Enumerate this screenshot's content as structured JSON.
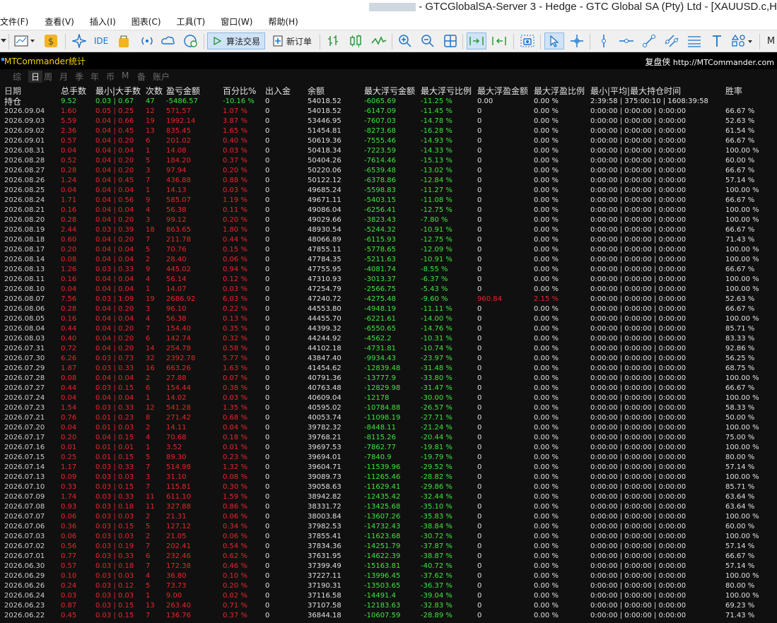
{
  "window": {
    "title": "- GTCGlobalSA-Server 3 - Hedge - GTC Global SA (Pty) Ltd - [XAUUSD.c,H"
  },
  "menu": [
    "文件(F)",
    "查看(V)",
    "插入(I)",
    "图表(C)",
    "工具(T)",
    "窗口(W)",
    "帮助(H)"
  ],
  "toolbar": {
    "ide_label": "IDE",
    "algo_label": "算法交易",
    "new_order_label": "新订单",
    "more_label": "M"
  },
  "panel": {
    "title": "MTCommander统计",
    "link_zh": "复盘侠",
    "link_url": "http://MTCommander.com",
    "tabs": [
      "综",
      "日",
      "周",
      "月",
      "季",
      "年",
      "币",
      "M",
      "备",
      "账户"
    ],
    "active_tab": "日",
    "headers": [
      "日期",
      "总手数",
      "最小|大手数",
      "次数",
      "盈亏金额",
      "百分比%",
      "出入金",
      "余额",
      "最大浮亏金额",
      "最大浮亏比例",
      "最大浮盈金额",
      "最大浮盈比例",
      "最小|平均|最大持仓时间",
      "胜率"
    ],
    "summary": {
      "label": "持仓",
      "lots": "9.52",
      "minmax": "0.03 | 0.67",
      "count": "47",
      "pl": "-5486.57",
      "pct": "-10.16 %",
      "deposit": "0",
      "balance": "54018.52",
      "max_float_loss": "-6065.69",
      "max_float_loss_pct": "-11.25 %",
      "max_float_profit": "0.00",
      "max_float_profit_pct": "0.00 %",
      "hold": "2:39:58 | 375:00:10 | 1608:39:58",
      "win": ""
    }
  },
  "rows": [
    [
      "2026.09.04",
      "1.60",
      "0.05 | 0.25",
      "12",
      "571.57",
      "1.07 %",
      "0",
      "54018.52",
      "-6147.09",
      "-11.45 %",
      "0",
      "0.00 %",
      "0:00:00 | 0:00:00 | 0:00:00",
      "66.67 %"
    ],
    [
      "2026.09.03",
      "5.59",
      "0.04 | 0.66",
      "19",
      "1992.14",
      "3.87 %",
      "0",
      "53446.95",
      "-7607.03",
      "-14.78 %",
      "0",
      "0.00 %",
      "0:00:00 | 0:00:00 | 0:00:00",
      "52.63 %"
    ],
    [
      "2026.09.02",
      "2.36",
      "0.04 | 0.45",
      "13",
      "835.45",
      "1.65 %",
      "0",
      "51454.81",
      "-8273.68",
      "-16.28 %",
      "0",
      "0.00 %",
      "0:00:00 | 0:00:00 | 0:00:00",
      "61.54 %"
    ],
    [
      "2026.09.01",
      "0.57",
      "0.04 | 0.20",
      "6",
      "201.02",
      "0.40 %",
      "0",
      "50619.36",
      "-7555.46",
      "-14.93 %",
      "0",
      "0.00 %",
      "0:00:00 | 0:00:00 | 0:00:00",
      "66.67 %"
    ],
    [
      "2026.08.31",
      "0.04",
      "0.04 | 0.04",
      "1",
      "14.08",
      "0.03 %",
      "0",
      "50418.34",
      "-7223.59",
      "-14.33 %",
      "0",
      "0.00 %",
      "0:00:00 | 0:00:00 | 0:00:00",
      "100.00 %"
    ],
    [
      "2026.08.28",
      "0.52",
      "0.04 | 0.20",
      "5",
      "184.20",
      "0.37 %",
      "0",
      "50404.26",
      "-7614.46",
      "-15.13 %",
      "0",
      "0.00 %",
      "0:00:00 | 0:00:00 | 0:00:00",
      "60.00 %"
    ],
    [
      "2026.08.27",
      "0.28",
      "0.04 | 0.20",
      "3",
      "97.94",
      "0.20 %",
      "0",
      "50220.06",
      "-6539.48",
      "-13.02 %",
      "0",
      "0.00 %",
      "0:00:00 | 0:00:00 | 0:00:00",
      "66.67 %"
    ],
    [
      "2026.08.26",
      "1.24",
      "0.04 | 0.45",
      "7",
      "436.88",
      "0.88 %",
      "0",
      "50122.12",
      "-6378.86",
      "-12.84 %",
      "0",
      "0.00 %",
      "0:00:00 | 0:00:00 | 0:00:00",
      "57.14 %"
    ],
    [
      "2026.08.25",
      "0.04",
      "0.04 | 0.04",
      "1",
      "14.13",
      "0.03 %",
      "0",
      "49685.24",
      "-5598.83",
      "-11.27 %",
      "0",
      "0.00 %",
      "0:00:00 | 0:00:00 | 0:00:00",
      "100.00 %"
    ],
    [
      "2026.08.24",
      "1.71",
      "0.04 | 0.56",
      "9",
      "585.07",
      "1.19 %",
      "0",
      "49671.11",
      "-5403.15",
      "-11.08 %",
      "0",
      "0.00 %",
      "0:00:00 | 0:00:00 | 0:00:00",
      "66.67 %"
    ],
    [
      "2026.08.21",
      "0.16",
      "0.04 | 0.04",
      "4",
      "56.38",
      "0.11 %",
      "0",
      "49086.04",
      "-6256.41",
      "-12.75 %",
      "0",
      "0.00 %",
      "0:00:00 | 0:00:00 | 0:00:00",
      "100.00 %"
    ],
    [
      "2026.08.20",
      "0.28",
      "0.04 | 0.20",
      "3",
      "99.12",
      "0.20 %",
      "0",
      "49029.66",
      "-3823.43",
      "-7.80 %",
      "0",
      "0.00 %",
      "0:00:00 | 0:00:00 | 0:00:00",
      "100.00 %"
    ],
    [
      "2026.08.19",
      "2.44",
      "0.03 | 0.39",
      "18",
      "863.65",
      "1.80 %",
      "0",
      "48930.54",
      "-5244.32",
      "-10.91 %",
      "0",
      "0.00 %",
      "0:00:00 | 0:00:00 | 0:00:00",
      "66.67 %"
    ],
    [
      "2026.08.18",
      "0.60",
      "0.04 | 0.20",
      "7",
      "211.78",
      "0.44 %",
      "0",
      "48066.89",
      "-6115.93",
      "-12.75 %",
      "0",
      "0.00 %",
      "0:00:00 | 0:00:00 | 0:00:00",
      "71.43 %"
    ],
    [
      "2026.08.17",
      "0.20",
      "0.04 | 0.04",
      "5",
      "70.76",
      "0.15 %",
      "0",
      "47855.11",
      "-5778.65",
      "-12.09 %",
      "0",
      "0.00 %",
      "0:00:00 | 0:00:00 | 0:00:00",
      "100.00 %"
    ],
    [
      "2026.08.14",
      "0.08",
      "0.04 | 0.04",
      "2",
      "28.40",
      "0.06 %",
      "0",
      "47784.35",
      "-5211.63",
      "-10.91 %",
      "0",
      "0.00 %",
      "0:00:00 | 0:00:00 | 0:00:00",
      "100.00 %"
    ],
    [
      "2026.08.13",
      "1.26",
      "0.03 | 0.33",
      "9",
      "445.02",
      "0.94 %",
      "0",
      "47755.95",
      "-4081.74",
      "-8.55 %",
      "0",
      "0.00 %",
      "0:00:00 | 0:00:00 | 0:00:00",
      "66.67 %"
    ],
    [
      "2026.08.11",
      "0.16",
      "0.04 | 0.04",
      "4",
      "56.14",
      "0.12 %",
      "0",
      "47310.93",
      "-3013.37",
      "-6.37 %",
      "0",
      "0.00 %",
      "0:00:00 | 0:00:00 | 0:00:00",
      "100.00 %"
    ],
    [
      "2026.08.10",
      "0.04",
      "0.04 | 0.04",
      "1",
      "14.07",
      "0.03 %",
      "0",
      "47254.79",
      "-2566.75",
      "-5.43 %",
      "0",
      "0.00 %",
      "0:00:00 | 0:00:00 | 0:00:00",
      "100.00 %"
    ],
    [
      "2026.08.07",
      "7.56",
      "0.03 | 1.09",
      "19",
      "2686.92",
      "6.03 %",
      "0",
      "47240.72",
      "-4275.48",
      "-9.60 %",
      "960.84",
      "2.15 %",
      "0:00:00 | 0:00:00 | 0:00:00",
      "52.63 %"
    ],
    [
      "2026.08.06",
      "0.28",
      "0.04 | 0.20",
      "3",
      "96.10",
      "0.22 %",
      "0",
      "44553.80",
      "-4948.19",
      "-11.11 %",
      "0",
      "0.00 %",
      "0:00:00 | 0:00:00 | 0:00:00",
      "66.67 %"
    ],
    [
      "2026.08.05",
      "0.16",
      "0.04 | 0.04",
      "4",
      "56.38",
      "0.13 %",
      "0",
      "44455.70",
      "-6221.61",
      "-14.00 %",
      "0",
      "0.00 %",
      "0:00:00 | 0:00:00 | 0:00:00",
      "100.00 %"
    ],
    [
      "2026.08.04",
      "0.44",
      "0.04 | 0.20",
      "7",
      "154.40",
      "0.35 %",
      "0",
      "44399.32",
      "-6550.65",
      "-14.76 %",
      "0",
      "0.00 %",
      "0:00:00 | 0:00:00 | 0:00:00",
      "85.71 %"
    ],
    [
      "2026.08.03",
      "0.40",
      "0.04 | 0.20",
      "6",
      "142.74",
      "0.32 %",
      "0",
      "44244.92",
      "-4562.2",
      "-10.31 %",
      "0",
      "0.00 %",
      "0:00:00 | 0:00:00 | 0:00:00",
      "83.33 %"
    ],
    [
      "2026.07.31",
      "0.72",
      "0.04 | 0.20",
      "14",
      "254.78",
      "0.58 %",
      "0",
      "44102.18",
      "-4731.81",
      "-10.74 %",
      "0",
      "0.00 %",
      "0:00:00 | 0:00:00 | 0:00:00",
      "92.86 %"
    ],
    [
      "2026.07.30",
      "6.26",
      "0.03 | 0.73",
      "32",
      "2392.78",
      "5.77 %",
      "0",
      "43847.40",
      "-9934.43",
      "-23.97 %",
      "0",
      "0.00 %",
      "0:00:00 | 0:00:00 | 0:00:00",
      "56.25 %"
    ],
    [
      "2026.07.29",
      "1.87",
      "0.03 | 0.33",
      "16",
      "663.26",
      "1.63 %",
      "0",
      "41454.62",
      "-12839.48",
      "-31.48 %",
      "0",
      "0.00 %",
      "0:00:00 | 0:00:00 | 0:00:00",
      "68.75 %"
    ],
    [
      "2026.07.28",
      "0.08",
      "0.04 | 0.04",
      "2",
      "27.88",
      "0.07 %",
      "0",
      "40791.36",
      "-13777.9",
      "-33.80 %",
      "0",
      "0.00 %",
      "0:00:00 | 0:00:00 | 0:00:00",
      "100.00 %"
    ],
    [
      "2026.07.27",
      "0.44",
      "0.03 | 0.15",
      "6",
      "154.44",
      "0.38 %",
      "0",
      "40763.48",
      "-12829.98",
      "-31.47 %",
      "0",
      "0.00 %",
      "0:00:00 | 0:00:00 | 0:00:00",
      "66.67 %"
    ],
    [
      "2026.07.24",
      "0.04",
      "0.04 | 0.04",
      "1",
      "14.02",
      "0.03 %",
      "0",
      "40609.04",
      "-12178",
      "-30.00 %",
      "0",
      "0.00 %",
      "0:00:00 | 0:00:00 | 0:00:00",
      "100.00 %"
    ],
    [
      "2026.07.23",
      "1.54",
      "0.03 | 0.33",
      "12",
      "541.28",
      "1.35 %",
      "0",
      "40595.02",
      "-10784.88",
      "-26.57 %",
      "0",
      "0.00 %",
      "0:00:00 | 0:00:00 | 0:00:00",
      "58.33 %"
    ],
    [
      "2026.07.21",
      "0.76",
      "0.01 | 0.23",
      "8",
      "271.42",
      "0.68 %",
      "0",
      "40053.74",
      "-11098.19",
      "-27.71 %",
      "0",
      "0.00 %",
      "0:00:00 | 0:00:00 | 0:00:00",
      "50.00 %"
    ],
    [
      "2026.07.20",
      "0.04",
      "0.01 | 0.03",
      "2",
      "14.11",
      "0.04 %",
      "0",
      "39782.32",
      "-8448.11",
      "-21.24 %",
      "0",
      "0.00 %",
      "0:00:00 | 0:00:00 | 0:00:00",
      "100.00 %"
    ],
    [
      "2026.07.17",
      "0.20",
      "0.04 | 0.15",
      "4",
      "70.68",
      "0.18 %",
      "0",
      "39768.21",
      "-8115.26",
      "-20.44 %",
      "0",
      "0.00 %",
      "0:00:00 | 0:00:00 | 0:00:00",
      "75.00 %"
    ],
    [
      "2026.07.16",
      "0.01",
      "0.01 | 0.01",
      "1",
      "3.52",
      "0.01 %",
      "0",
      "39697.53",
      "-7862.77",
      "-19.81 %",
      "0",
      "0.00 %",
      "0:00:00 | 0:00:00 | 0:00:00",
      "100.00 %"
    ],
    [
      "2026.07.15",
      "0.25",
      "0.01 | 0.15",
      "5",
      "89.30",
      "0.23 %",
      "0",
      "39694.01",
      "-7840.9",
      "-19.79 %",
      "0",
      "0.00 %",
      "0:00:00 | 0:00:00 | 0:00:00",
      "80.00 %"
    ],
    [
      "2026.07.14",
      "1.17",
      "0.03 | 0.33",
      "7",
      "514.98",
      "1.32 %",
      "0",
      "39604.71",
      "-11539.96",
      "-29.52 %",
      "0",
      "0.00 %",
      "0:00:00 | 0:00:00 | 0:00:00",
      "57.14 %"
    ],
    [
      "2026.07.13",
      "0.09",
      "0.03 | 0.03",
      "3",
      "31.10",
      "0.08 %",
      "0",
      "39089.73",
      "-11265.46",
      "-28.82 %",
      "0",
      "0.00 %",
      "0:00:00 | 0:00:00 | 0:00:00",
      "100.00 %"
    ],
    [
      "2026.07.10",
      "0.33",
      "0.03 | 0.15",
      "7",
      "115.81",
      "0.30 %",
      "0",
      "39058.63",
      "-11629.41",
      "-29.86 %",
      "0",
      "0.00 %",
      "0:00:00 | 0:00:00 | 0:00:00",
      "85.71 %"
    ],
    [
      "2026.07.09",
      "1.74",
      "0.03 | 0.33",
      "11",
      "611.10",
      "1.59 %",
      "0",
      "38942.82",
      "-12435.42",
      "-32.44 %",
      "0",
      "0.00 %",
      "0:00:00 | 0:00:00 | 0:00:00",
      "63.64 %"
    ],
    [
      "2026.07.08",
      "0.93",
      "0.03 | 0.18",
      "11",
      "327.88",
      "0.86 %",
      "0",
      "38331.72",
      "-13425.68",
      "-35.10 %",
      "0",
      "0.00 %",
      "0:00:00 | 0:00:00 | 0:00:00",
      "63.64 %"
    ],
    [
      "2026.07.07",
      "0.06",
      "0.03 | 0.03",
      "2",
      "21.31",
      "0.06 %",
      "0",
      "38003.84",
      "-13607.26",
      "-35.83 %",
      "0",
      "0.00 %",
      "0:00:00 | 0:00:00 | 0:00:00",
      "100.00 %"
    ],
    [
      "2026.07.06",
      "0.36",
      "0.03 | 0.15",
      "5",
      "127.12",
      "0.34 %",
      "0",
      "37982.53",
      "-14732.43",
      "-38.84 %",
      "0",
      "0.00 %",
      "0:00:00 | 0:00:00 | 0:00:00",
      "60.00 %"
    ],
    [
      "2026.07.03",
      "0.06",
      "0.03 | 0.03",
      "2",
      "21.05",
      "0.06 %",
      "0",
      "37855.41",
      "-11623.68",
      "-30.72 %",
      "0",
      "0.00 %",
      "0:00:00 | 0:00:00 | 0:00:00",
      "100.00 %"
    ],
    [
      "2026.07.02",
      "0.56",
      "0.03 | 0.19",
      "7",
      "202.41",
      "0.54 %",
      "0",
      "37834.36",
      "-14251.79",
      "-37.87 %",
      "0",
      "0.00 %",
      "0:00:00 | 0:00:00 | 0:00:00",
      "57.14 %"
    ],
    [
      "2026.07.01",
      "0.77",
      "0.03 | 0.33",
      "6",
      "232.46",
      "0.62 %",
      "0",
      "37631.95",
      "-14622.39",
      "-38.87 %",
      "0",
      "0.00 %",
      "0:00:00 | 0:00:00 | 0:00:00",
      "66.67 %"
    ],
    [
      "2026.06.30",
      "0.57",
      "0.03 | 0.18",
      "7",
      "172.38",
      "0.46 %",
      "0",
      "37399.49",
      "-15163.81",
      "-40.72 %",
      "0",
      "0.00 %",
      "0:00:00 | 0:00:00 | 0:00:00",
      "57.14 %"
    ],
    [
      "2026.06.29",
      "0.10",
      "0.03 | 0.03",
      "4",
      "36.80",
      "0.10 %",
      "0",
      "37227.11",
      "-13996.45",
      "-37.62 %",
      "0",
      "0.00 %",
      "0:00:00 | 0:00:00 | 0:00:00",
      "100.00 %"
    ],
    [
      "2026.06.26",
      "0.24",
      "0.03 | 0.12",
      "5",
      "73.73",
      "0.20 %",
      "0",
      "37190.31",
      "-13503.65",
      "-36.37 %",
      "0",
      "0.00 %",
      "0:00:00 | 0:00:00 | 0:00:00",
      "80.00 %"
    ],
    [
      "2026.06.24",
      "0.03",
      "0.03 | 0.03",
      "1",
      "9.00",
      "0.02 %",
      "0",
      "37116.58",
      "-14491.4",
      "-39.04 %",
      "0",
      "0.00 %",
      "0:00:00 | 0:00:00 | 0:00:00",
      "100.00 %"
    ],
    [
      "2026.06.23",
      "0.87",
      "0.03 | 0.15",
      "13",
      "263.40",
      "0.71 %",
      "0",
      "37107.58",
      "-12183.63",
      "-32.83 %",
      "0",
      "0.00 %",
      "0:00:00 | 0:00:00 | 0:00:00",
      "69.23 %"
    ],
    [
      "2026.06.22",
      "0.45",
      "0.03 | 0.15",
      "7",
      "136.76",
      "0.37 %",
      "0",
      "36844.18",
      "-10607.59",
      "-28.89 %",
      "0",
      "0.00 %",
      "0:00:00 | 0:00:00 | 0:00:00",
      "71.43 %"
    ]
  ],
  "colors": {
    "profit": "#e8262b",
    "loss": "#3ee63e",
    "title": "#ffd200",
    "background": "#101010"
  }
}
